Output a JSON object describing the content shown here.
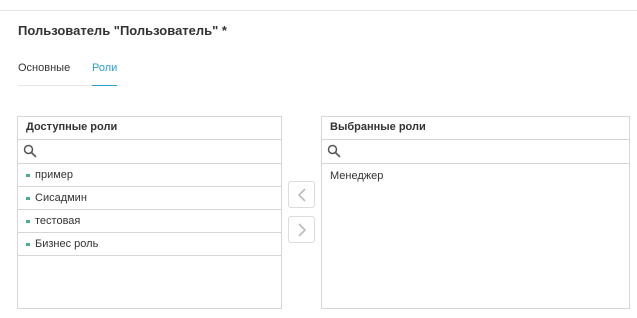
{
  "page": {
    "title": "Пользователь \"Пользователь\" *"
  },
  "tabs": [
    {
      "label": "Основные",
      "active": false
    },
    {
      "label": "Роли",
      "active": true
    }
  ],
  "available_roles": {
    "header": "Доступные роли",
    "search_placeholder": "",
    "items": [
      "пример",
      "Сисадмин",
      "тестовая",
      "Бизнес роль"
    ]
  },
  "selected_roles": {
    "header": "Выбранные роли",
    "search_placeholder": "",
    "items": [
      "Менеджер"
    ]
  },
  "icons": {
    "search": "search-icon",
    "move_left": "chevron-left-icon",
    "move_right": "chevron-right-icon"
  },
  "colors": {
    "accent": "#2a9fd6",
    "bullet": "#4caf8a",
    "border": "#d6d6d6"
  }
}
